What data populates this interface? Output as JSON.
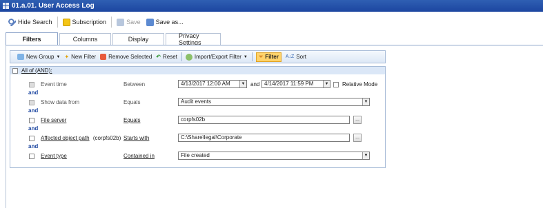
{
  "window": {
    "title": "01.a.01. User Access Log"
  },
  "toolbar": {
    "hide_search": "Hide Search",
    "subscription": "Subscription",
    "save": "Save",
    "save_as": "Save as..."
  },
  "tabs": [
    "Filters",
    "Columns",
    "Display",
    "Privacy Settings"
  ],
  "filterbar": {
    "new_group": "New Group",
    "new_filter": "New Filter",
    "remove_selected": "Remove Selected",
    "reset": "Reset",
    "import_export": "Import/Export Filter",
    "filter": "Filter",
    "sort": "Sort"
  },
  "group": {
    "label": "All of (AND):"
  },
  "and_label": "and",
  "rows": [
    {
      "field": "Event time",
      "operator": "Between",
      "value_from": "4/13/2017 12:00 AM",
      "joiner": "and",
      "value_to": "4/14/2017 11:59 PM",
      "relative_mode": "Relative Mode"
    },
    {
      "field": "Show data from",
      "operator": "Equals",
      "value": "Audit events"
    },
    {
      "field": "File server",
      "operator": "Equals",
      "value": "corpfs02b"
    },
    {
      "field": "Affected object path",
      "field_suffix": "(corpfs02b)",
      "operator": "Starts with",
      "value": "C:\\Share\\legal\\Corporate"
    },
    {
      "field": "Event type",
      "operator": "Contained in",
      "value": "File created"
    }
  ],
  "browse_label": "..."
}
